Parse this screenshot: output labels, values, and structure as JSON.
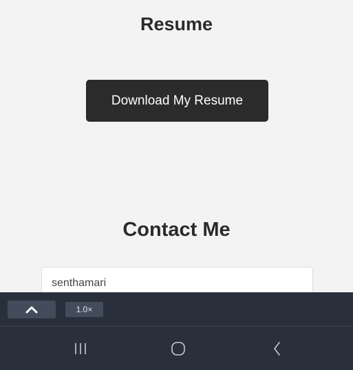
{
  "resume": {
    "title": "Resume",
    "download_button_label": "Download My Resume"
  },
  "contact": {
    "title": "Contact Me",
    "name_input_value": "senthamari"
  },
  "toolbar": {
    "collapse_icon": "chevron-up-icon",
    "zoom_level": "1.0×"
  },
  "navbar": {
    "recents_icon": "recent-apps-icon",
    "home_icon": "home-icon",
    "back_icon": "back-icon"
  },
  "colors": {
    "page_background": "#f3f3f3",
    "button_background": "#2b2b2b",
    "toolbar_background": "#2a303b",
    "toolbar_button": "#434c5b"
  }
}
